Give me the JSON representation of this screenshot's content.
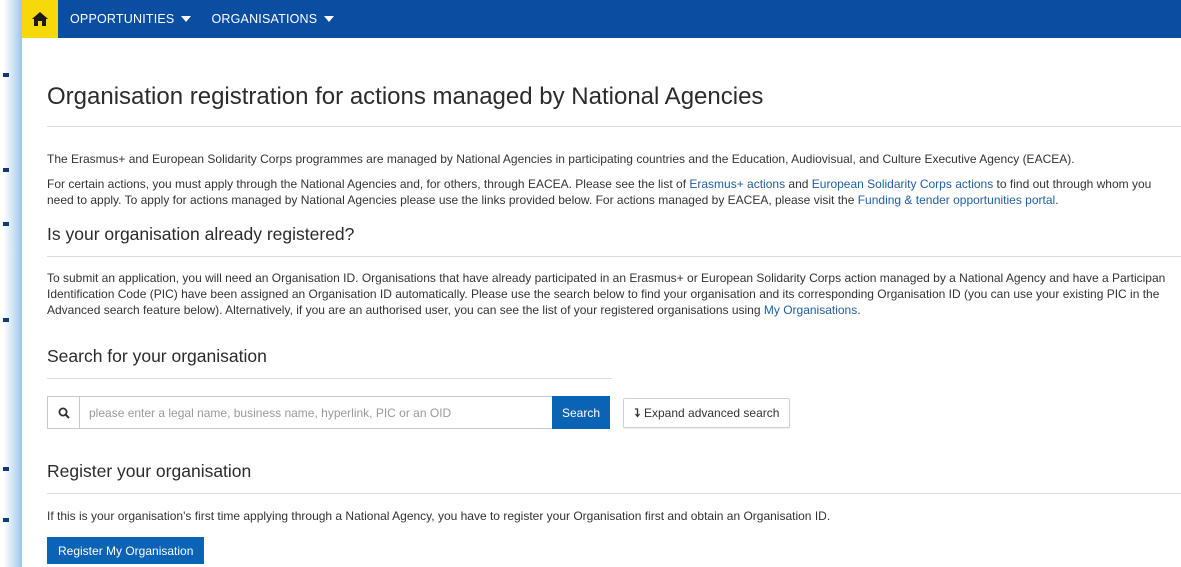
{
  "nav": {
    "items": [
      {
        "label": "OPPORTUNITIES"
      },
      {
        "label": "ORGANISATIONS"
      }
    ]
  },
  "page": {
    "title": "Organisation registration for actions managed by National Agencies",
    "intro": "The Erasmus+ and European Solidarity Corps programmes are managed by National Agencies in participating countries and the Education, Audiovisual, and Culture Executive Agency (EACEA).",
    "actions_para": {
      "p1": "For certain actions, you must apply through the National Agencies and, for others, through EACEA. Please see the list of ",
      "link1": "Erasmus+ actions",
      "p2": " and ",
      "link2": "European Solidarity Corps actions",
      "p3": " to find out through whom you need to apply. To apply for actions managed by National Agencies please use the links provided below. For actions managed by EACEA, please visit the ",
      "link3": "Funding & tender opportunities portal",
      "p4": "."
    }
  },
  "registered": {
    "heading": "Is your organisation already registered?",
    "p1": "To submit an application, you will need an Organisation ID. Organisations that have already participated in an Erasmus+ or European Solidarity Corps action managed by a National Agency and have a Participan Identification Code (PIC) have been assigned an Organisation ID automatically. Please use the search below to find your organisation and its corresponding Organisation ID (you can use your existing PIC in the Advanced search feature below). Alternatively, if you are an authorised user, you can see the list of your registered organisations using ",
    "link": "My Organisations",
    "p2": "."
  },
  "search": {
    "heading": "Search for your organisation",
    "placeholder": "please enter a legal name, business name, hyperlink, PIC or an OID",
    "button": "Search",
    "advanced": "Expand advanced search"
  },
  "register": {
    "heading": "Register your organisation",
    "text": "If this is your organisation's first time applying through a National Agency, you have to register your Organisation first and obtain an Organisation ID.",
    "button": "Register My Organisation"
  },
  "colors": {
    "nav_bg": "#0a4ea1",
    "home_bg": "#f5d90a",
    "primary_button": "#0a63b4",
    "link": "#1f5fa8"
  }
}
